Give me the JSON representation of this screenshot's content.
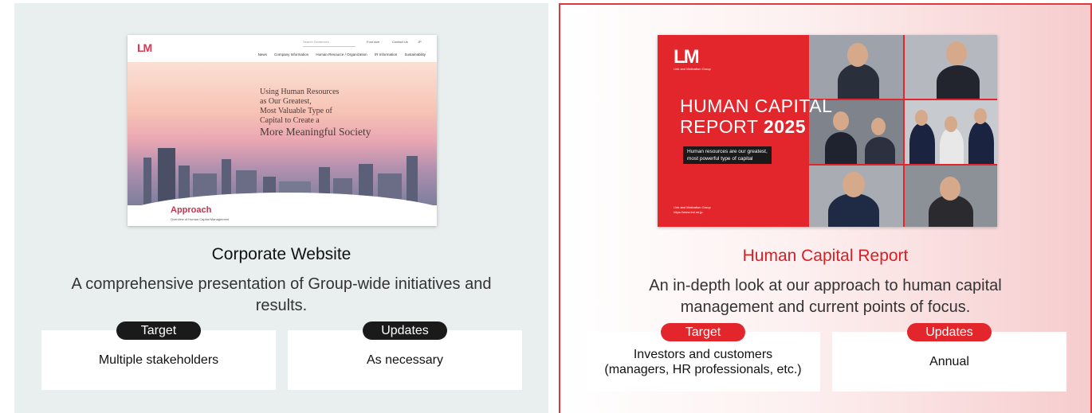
{
  "website": {
    "thumbnail": {
      "logo": "LM",
      "search_placeholder": "Search Sentences",
      "util_links": [
        "Font size",
        "Contact Us",
        "JP"
      ],
      "nav": [
        "News",
        "Company Information",
        "Human Resource / Organization",
        "IR Information",
        "Sustainability"
      ],
      "hero_lines": [
        "Using Human Resources",
        "as Our Greatest,",
        "Most Valuable Type of",
        "Capital to Create a",
        "More Meaningful Society"
      ],
      "section_title": "Approach",
      "section_subtitle": "Overview of Human Capital Management"
    },
    "title": "Corporate Website",
    "description": "A comprehensive presentation of Group-wide initiatives and results.",
    "target_label": "Target",
    "target_value": "Multiple stakeholders",
    "updates_label": "Updates",
    "updates_value": "As necessary"
  },
  "report": {
    "thumbnail": {
      "logo": "LM",
      "logo_sub": "Link and Motivation Group",
      "title_line1": "HUMAN CAPITAL",
      "title_line2": "REPORT",
      "year": "2025",
      "tagline_line1": "Human resources are our greatest,",
      "tagline_line2": "most powerful type of capital",
      "footer_line1": "Link and Motivation Group",
      "footer_line2": "https://www.lmi.ne.jp"
    },
    "title": "Human Capital Report",
    "description": "An in-depth look at our approach to human capital management and current points of focus.",
    "target_label": "Target",
    "target_value_line1": "Investors and customers",
    "target_value_line2": "(managers, HR professionals, etc.)",
    "updates_label": "Updates",
    "updates_value": "Annual"
  },
  "colors": {
    "accent_red": "#e3262b",
    "pill_dark": "#1a1a1a",
    "left_panel_bg": "#e9eeee"
  }
}
